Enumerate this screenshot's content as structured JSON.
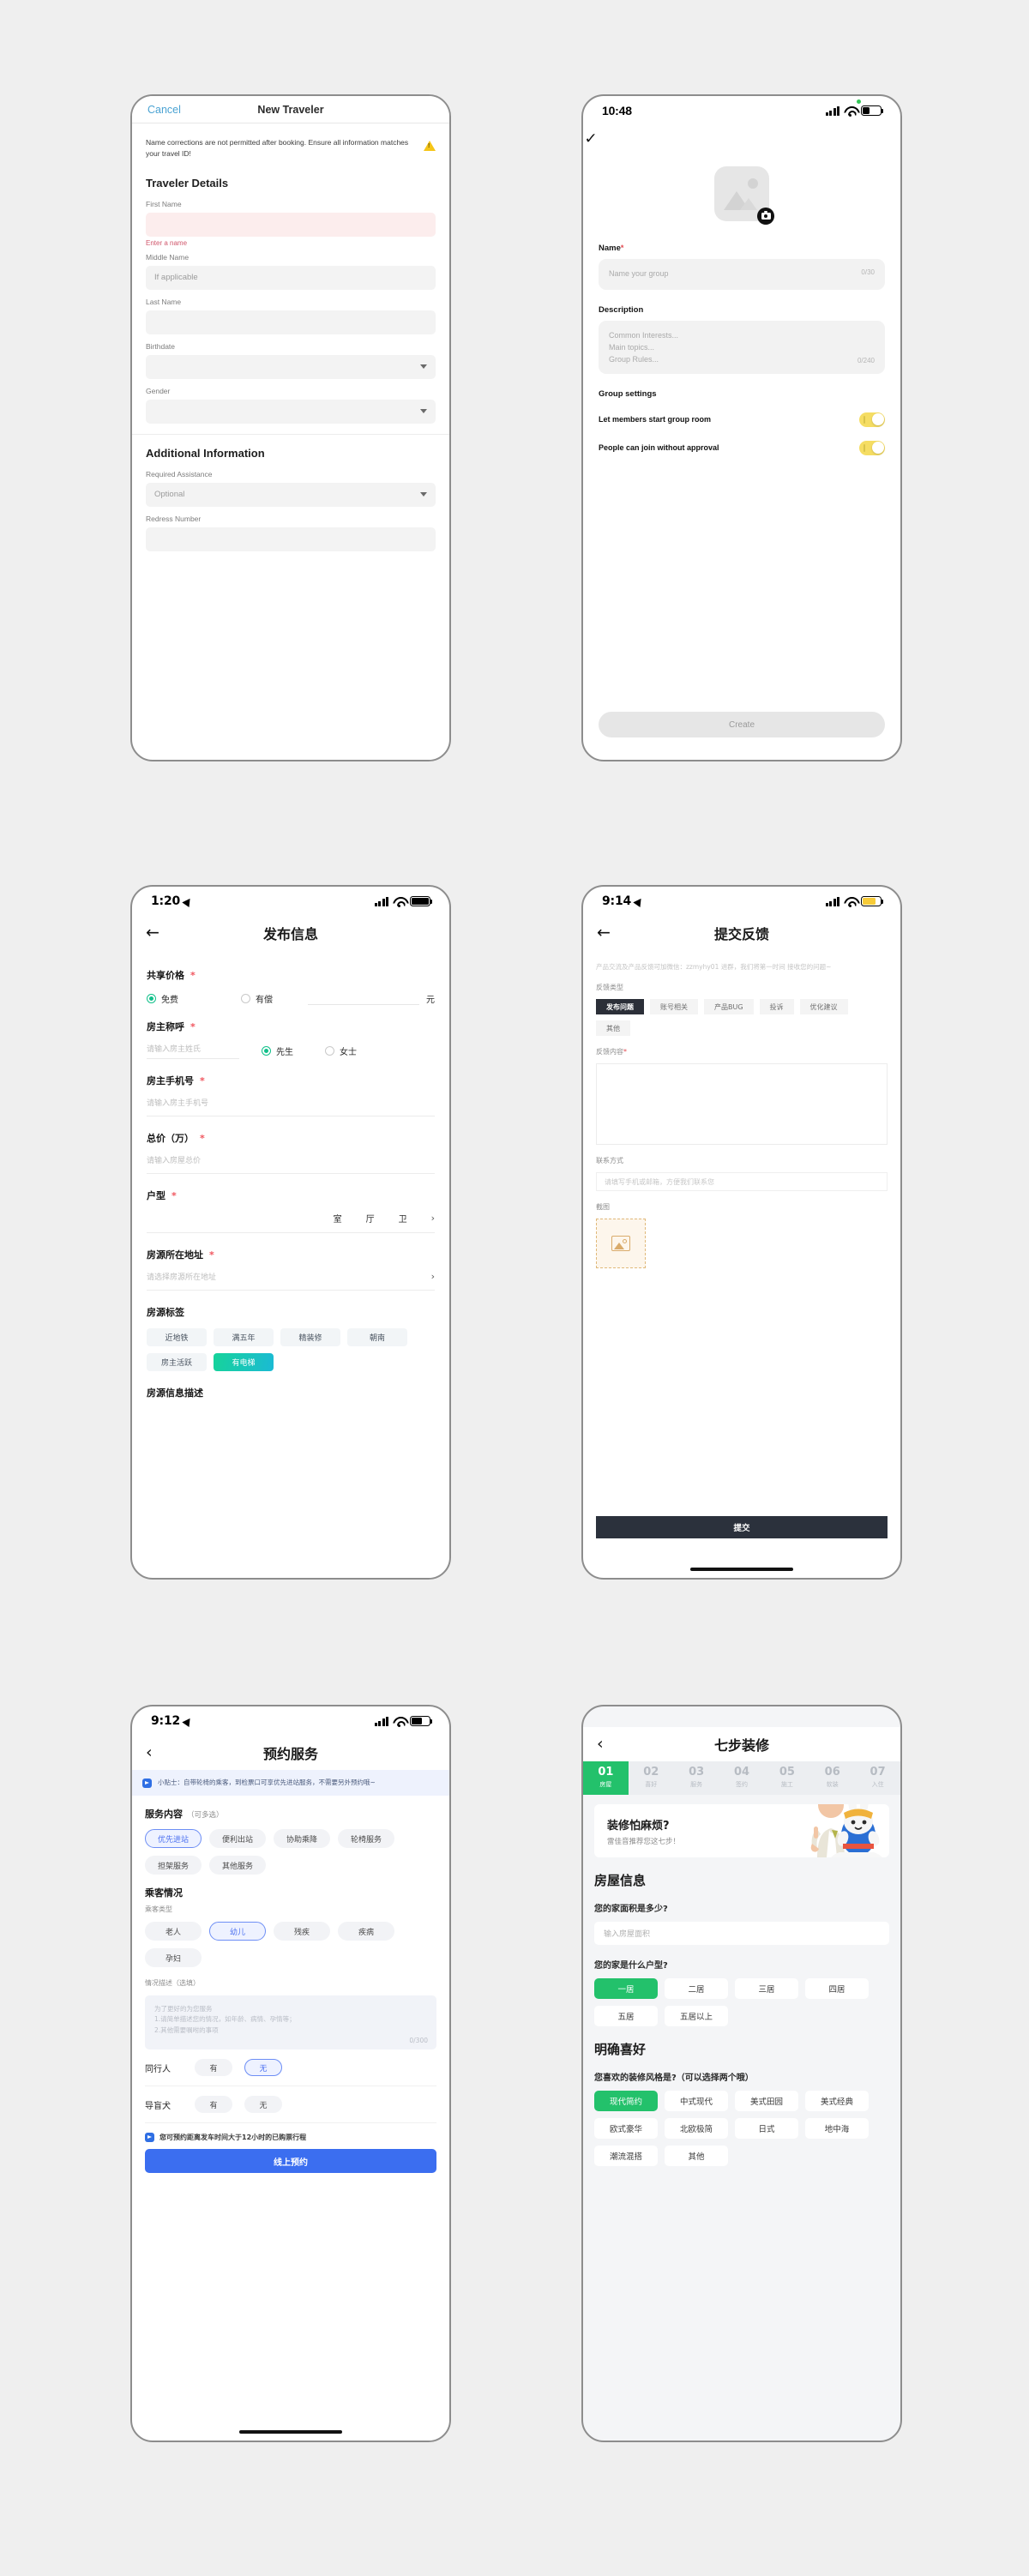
{
  "phone1": {
    "nav": {
      "cancel": "Cancel",
      "title": "New Traveler"
    },
    "warning": "Name corrections are not permitted after booking. Ensure all information matches your travel ID!",
    "warning_icon": "warning-triangle-icon",
    "section1_title": "Traveler Details",
    "fields": [
      {
        "label": "First Name",
        "value": "",
        "placeholder": "",
        "error": "Enter a name",
        "type": "text"
      },
      {
        "label": "Middle Name",
        "value": "",
        "placeholder": "If applicable",
        "type": "text"
      },
      {
        "label": "Last Name",
        "value": "",
        "placeholder": "",
        "type": "text"
      },
      {
        "label": "Birthdate",
        "value": "",
        "placeholder": "",
        "type": "select"
      },
      {
        "label": "Gender",
        "value": "",
        "placeholder": "",
        "type": "select"
      }
    ],
    "section2_title": "Additional Information",
    "fields2": [
      {
        "label": "Required Assistance",
        "value": "",
        "placeholder": "Optional",
        "type": "select"
      },
      {
        "label": "Redress Number",
        "value": "",
        "placeholder": "",
        "type": "text"
      }
    ]
  },
  "phone2": {
    "status": {
      "time": "10:48",
      "signal": "cellular-icon",
      "wifi": "wifi-icon",
      "battery": "battery-icon"
    },
    "back_icon": "chevron-down-icon",
    "avatar": {
      "icon": "image-placeholder-icon",
      "camera_icon": "camera-icon"
    },
    "name": {
      "label": "Name",
      "required": "*",
      "placeholder": "Name your group",
      "counter": "0/30"
    },
    "description": {
      "label": "Description",
      "placeholder": "Common Interests...\nMain topics...\nGroup Rules...",
      "counter": "0/240"
    },
    "settings_title": "Group settings",
    "toggles": [
      {
        "label": "Let members start group room",
        "on": true
      },
      {
        "label": "People can join without approval",
        "on": true
      }
    ],
    "toggle_color": "#f5dd63",
    "create_button": "Create"
  },
  "phone3": {
    "status": {
      "time": "1:20"
    },
    "nav": {
      "back_icon": "arrow-left-icon",
      "title": "发布信息"
    },
    "price": {
      "label": "共享价格",
      "required": "*",
      "options": [
        {
          "label": "免费",
          "selected": true
        },
        {
          "label": "有偿",
          "selected": false
        }
      ],
      "unit": "元"
    },
    "owner_title": {
      "label": "房主称呼",
      "required": "*",
      "input_placeholder": "请输入房主姓氏",
      "options": [
        {
          "label": "先生",
          "selected": true
        },
        {
          "label": "女士",
          "selected": false
        }
      ]
    },
    "phone": {
      "label": "房主手机号",
      "required": "*",
      "placeholder": "请输入房主手机号"
    },
    "total": {
      "label": "总价（万）",
      "required": "*",
      "placeholder": "请输入房屋总价"
    },
    "layout": {
      "label": "户型",
      "required": "*",
      "units": [
        "室",
        "厅",
        "卫"
      ],
      "chevron": "chevron-right-icon"
    },
    "address": {
      "label": "房源所在地址",
      "required": "*",
      "placeholder": "请选择房源所在地址",
      "chevron": "chevron-right-icon"
    },
    "tags": {
      "label": "房源标签",
      "items": [
        {
          "label": "近地铁",
          "selected": false
        },
        {
          "label": "满五年",
          "selected": false
        },
        {
          "label": "精装修",
          "selected": false
        },
        {
          "label": "朝南",
          "selected": false
        },
        {
          "label": "房主活跃",
          "selected": false
        },
        {
          "label": "有电梯",
          "selected": true
        }
      ],
      "selected_color": "#16d39a"
    },
    "desc_title": "房源信息描述",
    "radio_color": "#11c08a"
  },
  "phone4": {
    "status": {
      "time": "9:14"
    },
    "nav": {
      "back_icon": "arrow-left-icon",
      "title": "提交反馈"
    },
    "intro": "产品交流及产品反馈可加微信：zzmyhy01 进群，我们将第一时间 接收您的问题~",
    "type": {
      "label": "反馈类型",
      "items": [
        {
          "label": "发布问题",
          "selected": true
        },
        {
          "label": "账号相关",
          "selected": false
        },
        {
          "label": "产品BUG",
          "selected": false
        },
        {
          "label": "投诉",
          "selected": false
        },
        {
          "label": "优化建议",
          "selected": false
        },
        {
          "label": "其他",
          "selected": false
        }
      ],
      "selected_color": "#2b2f38"
    },
    "content": {
      "label": "反馈内容",
      "required": "*",
      "value": ""
    },
    "contact": {
      "label": "联系方式",
      "placeholder": "请填写手机或邮箱，方便我们联系您"
    },
    "screenshot": {
      "label": "截图",
      "upload_icon": "image-upload-icon"
    },
    "submit": "提交"
  },
  "phone5": {
    "status": {
      "time": "9:12"
    },
    "nav": {
      "back_icon": "chevron-left-icon",
      "title": "预约服务"
    },
    "tip": {
      "icon": "info-icon",
      "text": "小贴士：自带轮椅的乘客，到检票口可享优先进站服务，不需要另外预约哦~"
    },
    "service": {
      "label": "服务内容",
      "hint": "（可多选）",
      "items": [
        {
          "label": "优先进站",
          "selected": true
        },
        {
          "label": "便利出站",
          "selected": false
        },
        {
          "label": "协助乘降",
          "selected": false
        },
        {
          "label": "轮椅服务",
          "selected": false
        },
        {
          "label": "担架服务",
          "selected": false
        },
        {
          "label": "其他服务",
          "selected": false
        }
      ]
    },
    "passenger": {
      "label": "乘客情况",
      "sub": "乘客类型",
      "items": [
        {
          "label": "老人",
          "selected": false
        },
        {
          "label": "幼儿",
          "selected": true
        },
        {
          "label": "残疾",
          "selected": false
        },
        {
          "label": "疾病",
          "selected": false
        },
        {
          "label": "孕妇",
          "selected": false
        }
      ]
    },
    "situation": {
      "label": "情况描述",
      "hint": "（选填）",
      "placeholder": "为了更好的为您服务\n1.请简单描述您的情况，如年龄、病情、孕情等；\n2.其他需要嘱咐的事项",
      "counter": "0/300"
    },
    "rows": [
      {
        "label": "同行人",
        "options": [
          {
            "label": "有",
            "selected": false
          },
          {
            "label": "无",
            "selected": true
          }
        ]
      },
      {
        "label": "导盲犬",
        "options": [
          {
            "label": "有",
            "selected": false
          },
          {
            "label": "无",
            "selected": false
          }
        ]
      }
    ],
    "notice": {
      "icon": "info-icon",
      "text": "您可预约距离发车时间大于12小时的已购票行程"
    },
    "cta": "线上预约",
    "accent_color": "#3b6ef0"
  },
  "phone6": {
    "nav": {
      "back_icon": "chevron-left-icon",
      "title": "七步装修"
    },
    "steps": [
      {
        "num": "01",
        "label": "房屋",
        "active": true
      },
      {
        "num": "02",
        "label": "喜好",
        "active": false
      },
      {
        "num": "03",
        "label": "服务",
        "active": false
      },
      {
        "num": "04",
        "label": "签约",
        "active": false
      },
      {
        "num": "05",
        "label": "施工",
        "active": false
      },
      {
        "num": "06",
        "label": "软装",
        "active": false
      },
      {
        "num": "07",
        "label": "入住",
        "active": false
      }
    ],
    "banner": {
      "title": "装修怕麻烦?",
      "subtitle": "雷佳音推荐您这七步！",
      "image": "mascot-photo"
    },
    "house_section": "房屋信息",
    "area_question": "您的家面积是多少?",
    "area_placeholder": "输入房屋面积",
    "layout_question": "您的家是什么户型?",
    "layout_options": [
      {
        "label": "一居",
        "selected": true
      },
      {
        "label": "二居",
        "selected": false
      },
      {
        "label": "三居",
        "selected": false
      },
      {
        "label": "四居",
        "selected": false
      },
      {
        "label": "五居",
        "selected": false
      },
      {
        "label": "五居以上",
        "selected": false
      }
    ],
    "pref_section": "明确喜好",
    "style_question": "您喜欢的装修风格是?（可以选择两个哦）",
    "style_options": [
      {
        "label": "现代简约",
        "selected": true
      },
      {
        "label": "中式现代",
        "selected": false
      },
      {
        "label": "美式田园",
        "selected": false
      },
      {
        "label": "美式经典",
        "selected": false
      },
      {
        "label": "欧式豪华",
        "selected": false
      },
      {
        "label": "北欧极简",
        "selected": false
      },
      {
        "label": "日式",
        "selected": false
      },
      {
        "label": "地中海",
        "selected": false
      },
      {
        "label": "潮流混搭",
        "selected": false
      },
      {
        "label": "其他",
        "selected": false
      }
    ],
    "accent_color": "#23c16b"
  }
}
